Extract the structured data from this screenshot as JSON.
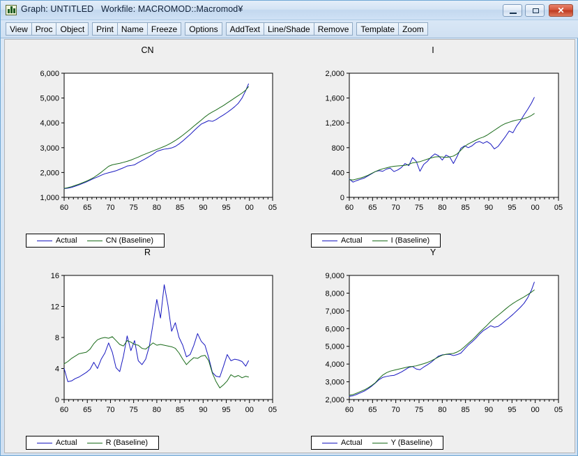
{
  "window": {
    "title": "Graph: UNTITLED   Workfile: MACROMOD::Macromod¥",
    "icon": "bar-chart-icon",
    "controls": {
      "minimize": "–",
      "maximize": "□",
      "close": "✕"
    }
  },
  "toolbar": {
    "groups": [
      [
        "View",
        "Proc",
        "Object"
      ],
      [
        "Print",
        "Name",
        "Freeze"
      ],
      [
        "Options"
      ],
      [
        "AddText",
        "Line/Shade",
        "Remove"
      ],
      [
        "Template",
        "Zoom"
      ]
    ]
  },
  "colors": {
    "actual": "#1818c0",
    "baseline": "#1a6b1a",
    "axis": "#000000",
    "panel_background": "#efefef",
    "plot_background": "#ffffff",
    "titlebar_accent": "#c3d8ef",
    "close_button": "#d4563a"
  },
  "chart_data": [
    {
      "type": "line",
      "title": "CN",
      "xlabel": "",
      "ylabel": "",
      "xlim": [
        1960,
        2005
      ],
      "ylim": [
        1000,
        6000
      ],
      "xticks": [
        "60",
        "65",
        "70",
        "75",
        "80",
        "85",
        "90",
        "95",
        "00",
        "05"
      ],
      "yticks": [
        "1,000",
        "2,000",
        "3,000",
        "4,000",
        "5,000",
        "6,000"
      ],
      "grid": false,
      "legend_position": "below",
      "x": [
        1960.0,
        1960.8,
        1961.6,
        1962.4,
        1963.2,
        1964.0,
        1964.8,
        1965.6,
        1966.4,
        1967.2,
        1968.0,
        1968.8,
        1969.6,
        1970.4,
        1971.2,
        1972.0,
        1972.8,
        1973.6,
        1974.4,
        1975.2,
        1976.0,
        1976.8,
        1977.6,
        1978.4,
        1979.2,
        1980.0,
        1980.8,
        1981.6,
        1982.4,
        1983.2,
        1984.0,
        1984.8,
        1985.6,
        1986.4,
        1987.2,
        1988.0,
        1988.8,
        1989.6,
        1990.4,
        1991.2,
        1992.0,
        1992.8,
        1993.6,
        1994.4,
        1995.2,
        1996.0,
        1996.8,
        1997.6,
        1998.4,
        1999.2,
        1999.8
      ],
      "series": [
        {
          "name": "Actual",
          "color": "#1818c0",
          "values": [
            1350,
            1370,
            1400,
            1450,
            1500,
            1560,
            1620,
            1690,
            1760,
            1820,
            1890,
            1950,
            1990,
            2030,
            2070,
            2130,
            2190,
            2260,
            2280,
            2310,
            2400,
            2480,
            2560,
            2650,
            2740,
            2850,
            2900,
            2940,
            2960,
            2990,
            3050,
            3150,
            3270,
            3400,
            3530,
            3680,
            3820,
            3950,
            4020,
            4090,
            4060,
            4130,
            4230,
            4320,
            4420,
            4530,
            4650,
            4790,
            5000,
            5300,
            5570
          ]
        },
        {
          "name": "CN (Baseline)",
          "color": "#1a6b1a",
          "values": [
            1360,
            1390,
            1430,
            1480,
            1530,
            1590,
            1650,
            1720,
            1800,
            1900,
            2010,
            2130,
            2250,
            2310,
            2340,
            2370,
            2410,
            2450,
            2500,
            2560,
            2620,
            2690,
            2750,
            2810,
            2870,
            2930,
            2990,
            3050,
            3120,
            3200,
            3290,
            3390,
            3500,
            3620,
            3740,
            3870,
            3990,
            4110,
            4240,
            4350,
            4440,
            4520,
            4610,
            4700,
            4800,
            4900,
            5000,
            5100,
            5200,
            5320,
            5460
          ]
        }
      ]
    },
    {
      "type": "line",
      "title": "I",
      "xlabel": "",
      "ylabel": "",
      "xlim": [
        1960,
        2005
      ],
      "ylim": [
        0,
        2000
      ],
      "xticks": [
        "60",
        "65",
        "70",
        "75",
        "80",
        "85",
        "90",
        "95",
        "00",
        "05"
      ],
      "yticks": [
        "0",
        "400",
        "800",
        "1,200",
        "1,600",
        "2,000"
      ],
      "grid": false,
      "legend_position": "below",
      "x": [
        1960.0,
        1960.8,
        1961.6,
        1962.4,
        1963.2,
        1964.0,
        1964.8,
        1965.6,
        1966.4,
        1967.2,
        1968.0,
        1968.8,
        1969.6,
        1970.4,
        1971.2,
        1972.0,
        1972.8,
        1973.6,
        1974.4,
        1975.2,
        1976.0,
        1976.8,
        1977.6,
        1978.4,
        1979.2,
        1980.0,
        1980.8,
        1981.6,
        1982.4,
        1983.2,
        1984.0,
        1984.8,
        1985.6,
        1986.4,
        1987.2,
        1988.0,
        1988.8,
        1989.6,
        1990.4,
        1991.2,
        1992.0,
        1992.8,
        1993.6,
        1994.4,
        1995.2,
        1996.0,
        1996.8,
        1997.6,
        1998.4,
        1999.2,
        1999.8
      ],
      "series": [
        {
          "name": "Actual",
          "color": "#1818c0",
          "values": [
            295,
            245,
            270,
            290,
            310,
            345,
            380,
            415,
            430,
            420,
            455,
            470,
            415,
            440,
            480,
            545,
            510,
            640,
            580,
            420,
            530,
            580,
            650,
            700,
            670,
            600,
            680,
            650,
            545,
            660,
            790,
            830,
            800,
            830,
            880,
            900,
            870,
            900,
            860,
            780,
            820,
            900,
            980,
            1070,
            1040,
            1150,
            1230,
            1330,
            1420,
            1520,
            1610
          ]
        },
        {
          "name": "I (Baseline)",
          "color": "#1a6b1a",
          "values": [
            285,
            280,
            295,
            310,
            330,
            355,
            385,
            415,
            440,
            460,
            475,
            490,
            500,
            505,
            510,
            515,
            530,
            555,
            565,
            575,
            595,
            615,
            635,
            650,
            655,
            650,
            645,
            650,
            665,
            700,
            760,
            820,
            860,
            890,
            920,
            950,
            970,
            1000,
            1040,
            1080,
            1120,
            1160,
            1190,
            1210,
            1230,
            1245,
            1255,
            1270,
            1290,
            1320,
            1350
          ]
        }
      ]
    },
    {
      "type": "line",
      "title": "R",
      "xlabel": "",
      "ylabel": "",
      "xlim": [
        1960,
        2005
      ],
      "ylim": [
        0,
        16
      ],
      "xticks": [
        "60",
        "65",
        "70",
        "75",
        "80",
        "85",
        "90",
        "95",
        "00",
        "05"
      ],
      "yticks": [
        "0",
        "4",
        "8",
        "12",
        "16"
      ],
      "grid": false,
      "legend_position": "below",
      "x": [
        1960.0,
        1960.8,
        1961.6,
        1962.4,
        1963.2,
        1964.0,
        1964.8,
        1965.6,
        1966.4,
        1967.2,
        1968.0,
        1968.8,
        1969.6,
        1970.4,
        1971.2,
        1972.0,
        1972.8,
        1973.6,
        1974.4,
        1975.2,
        1976.0,
        1976.8,
        1977.6,
        1978.4,
        1979.2,
        1980.0,
        1980.8,
        1981.6,
        1982.4,
        1983.2,
        1984.0,
        1984.8,
        1985.6,
        1986.4,
        1987.2,
        1988.0,
        1988.8,
        1989.6,
        1990.4,
        1991.2,
        1992.0,
        1992.8,
        1993.6,
        1994.4,
        1995.2,
        1996.0,
        1996.8,
        1997.6,
        1998.4,
        1999.2,
        1999.8
      ],
      "series": [
        {
          "name": "Actual",
          "color": "#1818c0",
          "values": [
            4.0,
            2.3,
            2.4,
            2.7,
            2.9,
            3.2,
            3.5,
            3.9,
            4.8,
            4.0,
            5.2,
            6.0,
            7.3,
            6.1,
            4.1,
            3.6,
            5.6,
            8.2,
            6.3,
            7.6,
            5.0,
            4.5,
            5.2,
            6.9,
            9.8,
            12.9,
            10.5,
            14.8,
            12.2,
            8.8,
            9.9,
            8.0,
            7.0,
            5.5,
            5.8,
            7.0,
            8.5,
            7.5,
            7.0,
            5.4,
            3.5,
            3.0,
            2.9,
            4.3,
            5.8,
            5.0,
            5.2,
            5.1,
            4.9,
            4.3,
            5.0
          ]
        },
        {
          "name": "R (Baseline)",
          "color": "#1a6b1a",
          "values": [
            4.6,
            4.9,
            5.3,
            5.6,
            5.9,
            6.0,
            6.1,
            6.5,
            7.2,
            7.7,
            7.9,
            8.0,
            7.9,
            8.1,
            7.6,
            7.1,
            6.9,
            7.6,
            7.4,
            7.1,
            7.0,
            6.6,
            6.5,
            6.9,
            7.3,
            7.0,
            7.1,
            7.0,
            6.9,
            6.8,
            6.6,
            6.0,
            5.2,
            4.5,
            5.0,
            5.4,
            5.3,
            5.6,
            5.7,
            5.0,
            3.4,
            2.3,
            1.5,
            1.9,
            2.4,
            3.2,
            2.9,
            3.1,
            2.8,
            3.0,
            2.9
          ]
        }
      ]
    },
    {
      "type": "line",
      "title": "Y",
      "xlabel": "",
      "ylabel": "",
      "xlim": [
        1960,
        2005
      ],
      "ylim": [
        2000,
        9000
      ],
      "xticks": [
        "60",
        "65",
        "70",
        "75",
        "80",
        "85",
        "90",
        "95",
        "00",
        "05"
      ],
      "yticks": [
        "2,000",
        "3,000",
        "4,000",
        "5,000",
        "6,000",
        "7,000",
        "8,000",
        "9,000"
      ],
      "grid": false,
      "legend_position": "below",
      "x": [
        1960.0,
        1960.8,
        1961.6,
        1962.4,
        1963.2,
        1964.0,
        1964.8,
        1965.6,
        1966.4,
        1967.2,
        1968.0,
        1968.8,
        1969.6,
        1970.4,
        1971.2,
        1972.0,
        1972.8,
        1973.6,
        1974.4,
        1975.2,
        1976.0,
        1976.8,
        1977.6,
        1978.4,
        1979.2,
        1980.0,
        1980.8,
        1981.6,
        1982.4,
        1983.2,
        1984.0,
        1984.8,
        1985.6,
        1986.4,
        1987.2,
        1988.0,
        1988.8,
        1989.6,
        1990.4,
        1991.2,
        1992.0,
        1992.8,
        1993.6,
        1994.4,
        1995.2,
        1996.0,
        1996.8,
        1997.6,
        1998.4,
        1999.2,
        1999.8
      ],
      "series": [
        {
          "name": "Actual",
          "color": "#1818c0",
          "values": [
            2180,
            2210,
            2290,
            2380,
            2470,
            2600,
            2750,
            2930,
            3120,
            3250,
            3300,
            3340,
            3360,
            3450,
            3550,
            3680,
            3810,
            3860,
            3720,
            3680,
            3830,
            3960,
            4100,
            4280,
            4450,
            4520,
            4540,
            4550,
            4480,
            4530,
            4620,
            4850,
            5070,
            5250,
            5450,
            5680,
            5880,
            6010,
            6160,
            6080,
            6120,
            6270,
            6450,
            6620,
            6800,
            7000,
            7200,
            7430,
            7750,
            8180,
            8620
          ]
        },
        {
          "name": "Y (Baseline)",
          "color": "#1a6b1a",
          "values": [
            2240,
            2280,
            2360,
            2450,
            2540,
            2650,
            2790,
            2950,
            3180,
            3380,
            3510,
            3600,
            3650,
            3700,
            3750,
            3800,
            3850,
            3870,
            3900,
            3960,
            4020,
            4090,
            4180,
            4290,
            4400,
            4500,
            4550,
            4580,
            4600,
            4680,
            4800,
            4980,
            5170,
            5350,
            5560,
            5780,
            5980,
            6180,
            6400,
            6580,
            6750,
            6920,
            7100,
            7270,
            7420,
            7550,
            7670,
            7790,
            7920,
            8060,
            8180
          ]
        }
      ]
    }
  ]
}
